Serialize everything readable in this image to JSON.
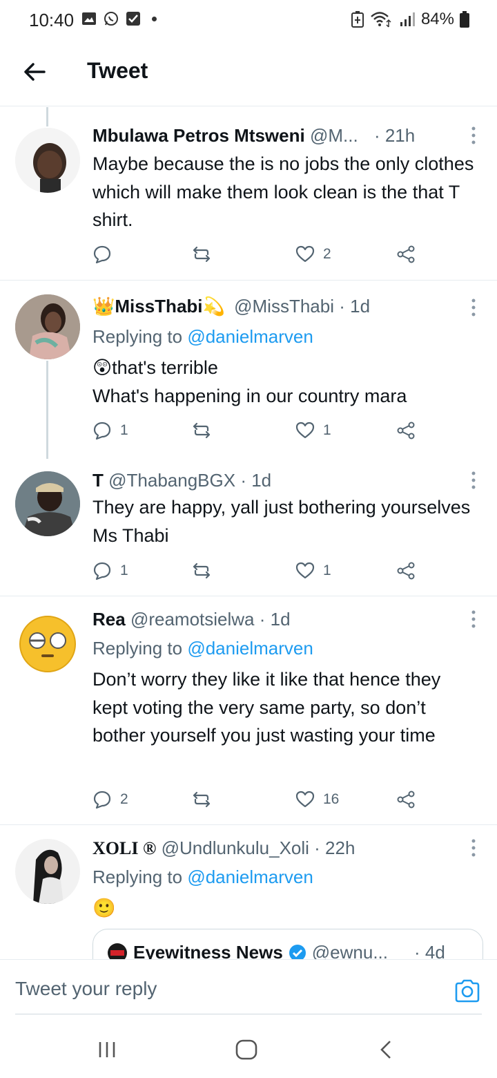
{
  "status": {
    "time": "10:40",
    "battery": "84%"
  },
  "header": {
    "title": "Tweet"
  },
  "tweets": [
    {
      "name": "Mbulawa Petros Mtsweni",
      "handle": "@M...",
      "time": "· 21h",
      "replying_prefix": "",
      "replying_to": "",
      "text": "Maybe because the is no jobs the only clothes which will make them look clean is the that T shirt.",
      "replies": "",
      "likes": "2"
    },
    {
      "name": "MissThabi",
      "handle": "@MissThabi",
      "time": "· 1d",
      "replying_prefix": "Replying to",
      "replying_to": "@danielmarven",
      "text_emoji": "😲",
      "text_line1": "that's terrible",
      "text_line2": "What's happening in our country mara",
      "replies": "1",
      "likes": "1"
    },
    {
      "name": "T",
      "handle": "@ThabangBGX",
      "time": "· 1d",
      "text": "They are happy, yall just bothering yourselves Ms Thabi",
      "replies": "1",
      "likes": "1"
    },
    {
      "name": "Rea",
      "handle": "@reamotsielwa",
      "time": "· 1d",
      "replying_prefix": "Replying to",
      "replying_to": "@danielmarven",
      "text": "Don’t worry they like it like that hence they kept voting the very same party, so don’t bother yourself you just wasting your time",
      "replies": "2",
      "likes": "16"
    },
    {
      "name": "XOLI ®",
      "handle": "@Undlunkulu_Xoli",
      "time": "· 22h",
      "replying_prefix": "Replying to",
      "replying_to": "@danielmarven",
      "text_emoji": "🙂",
      "quote": {
        "name": "Eyewitness News",
        "handle": "@ewnu...",
        "time": "· 4d"
      }
    }
  ],
  "reply_bar": {
    "placeholder": "Tweet your reply"
  },
  "colors": {
    "accent": "#1d9bf0",
    "text": "#0f1419",
    "muted": "#536471",
    "divider": "#e6ecf0"
  }
}
